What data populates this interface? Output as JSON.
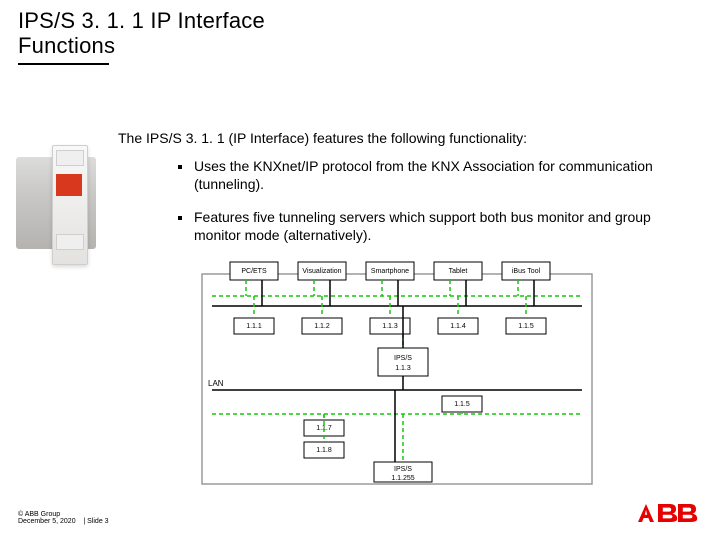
{
  "title": {
    "line1": "IPS/S 3. 1. 1 IP Interface",
    "line2": "Functions"
  },
  "intro": "The IPS/S 3. 1. 1 (IP Interface) features the following functionality:",
  "bullets": [
    "Uses the KNXnet/IP protocol from the KNX Association for communication (tunneling).",
    "Features five tunneling servers which support both bus monitor and group monitor mode (alternatively)."
  ],
  "diagram": {
    "top": [
      "PC/ETS",
      "Visualization",
      "Smartphone",
      "Tablet",
      "iBus Tool"
    ],
    "tunnel_addrs": [
      "1.1.1",
      "1.1.2",
      "1.1.3",
      "1.1.4",
      "1.1.5"
    ],
    "ips_box": "IPS/S",
    "ips_addr": "1.1.3",
    "lan": "LAN",
    "knx_addrs": [
      "1.1.5",
      "1.1.7",
      "1.1.8"
    ],
    "bottom_box": "IPS/S",
    "bottom_addr": "1.1.255"
  },
  "footer": {
    "line1": "© ABB Group",
    "date": "December 5, 2020",
    "slide": "| Slide 3"
  },
  "logo": "ABB"
}
